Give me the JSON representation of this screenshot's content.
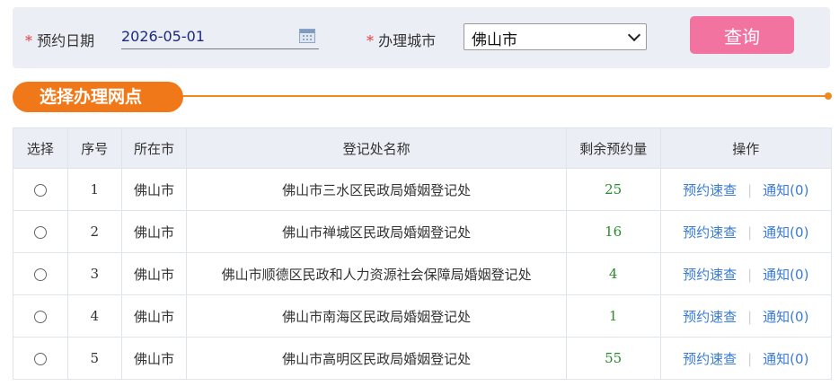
{
  "search": {
    "date_label": "预约日期",
    "date_value": "2026-05-01",
    "city_label": "办理城市",
    "city_value": "佛山市",
    "required_mark": "*",
    "query_button": "查询"
  },
  "section": {
    "title": "选择办理网点"
  },
  "table": {
    "headers": [
      "选择",
      "序号",
      "所在市",
      "登记处名称",
      "剩余预约量",
      "操作"
    ],
    "rows": [
      {
        "no": "1",
        "city": "佛山市",
        "name": "佛山市三水区民政局婚姻登记处",
        "remaining": "25",
        "action1": "预约速查",
        "action2": "通知(0)"
      },
      {
        "no": "2",
        "city": "佛山市",
        "name": "佛山市禅城区民政局婚姻登记处",
        "remaining": "16",
        "action1": "预约速查",
        "action2": "通知(0)"
      },
      {
        "no": "3",
        "city": "佛山市",
        "name": "佛山市顺德区民政和人力资源社会保障局婚姻登记处",
        "remaining": "4",
        "action1": "预约速查",
        "action2": "通知(0)"
      },
      {
        "no": "4",
        "city": "佛山市",
        "name": "佛山市南海区民政局婚姻登记处",
        "remaining": "1",
        "action1": "预约速查",
        "action2": "通知(0)"
      },
      {
        "no": "5",
        "city": "佛山市",
        "name": "佛山市高明区民政局婚姻登记处",
        "remaining": "55",
        "action1": "预约速查",
        "action2": "通知(0)"
      }
    ],
    "separator": "|"
  },
  "colors": {
    "accent": "#f07818",
    "button": "#f2739f",
    "link": "#3a7bd5",
    "remaining": "#2b8a2b",
    "required": "#e53d3d"
  }
}
